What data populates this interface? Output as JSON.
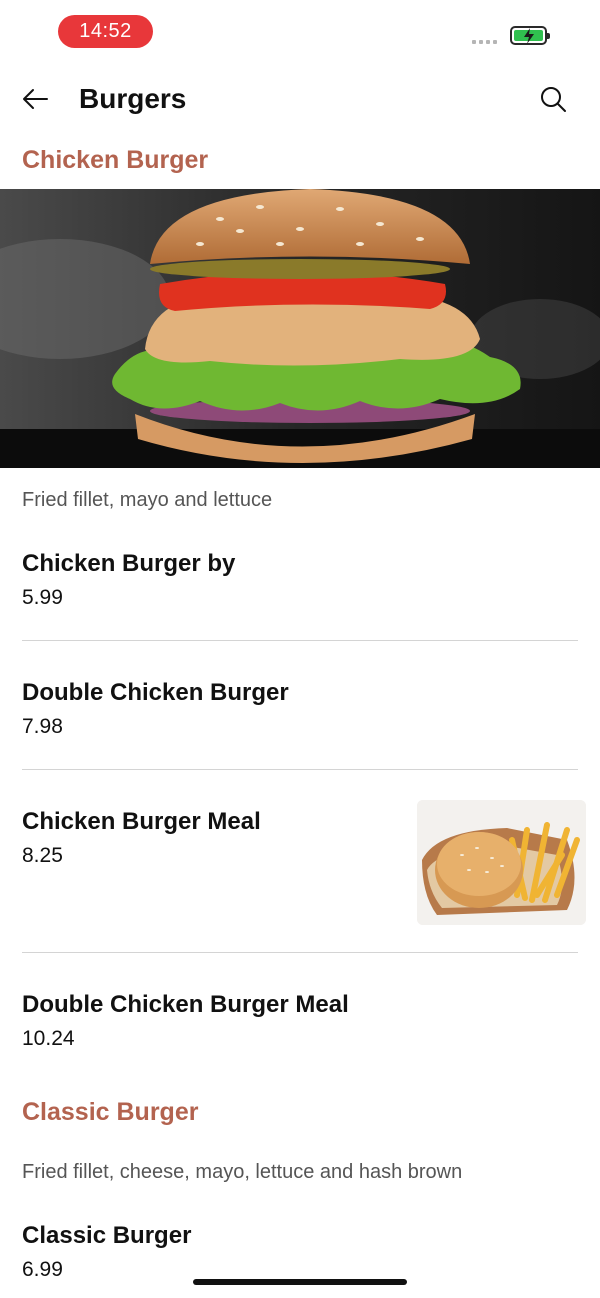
{
  "status_bar": {
    "time": "14:52"
  },
  "header": {
    "title": "Burgers"
  },
  "sections": [
    {
      "title": "Chicken Burger",
      "description": "Fried fillet, mayo and lettuce",
      "items": [
        {
          "name": "Chicken Burger by",
          "price": "5.99"
        },
        {
          "name": "Double Chicken Burger",
          "price": "7.98"
        },
        {
          "name": "Chicken Burger Meal",
          "price": "8.25"
        },
        {
          "name": "Double Chicken Burger Meal",
          "price": "10.24"
        }
      ]
    },
    {
      "title": "Classic Burger",
      "description": "Fried fillet, cheese, mayo, lettuce and hash brown",
      "items": [
        {
          "name": "Classic Burger",
          "price": "6.99"
        }
      ]
    }
  ],
  "colors": {
    "accent": "#b3634f",
    "time_pill": "#e8373a",
    "battery": "#30c04f"
  }
}
